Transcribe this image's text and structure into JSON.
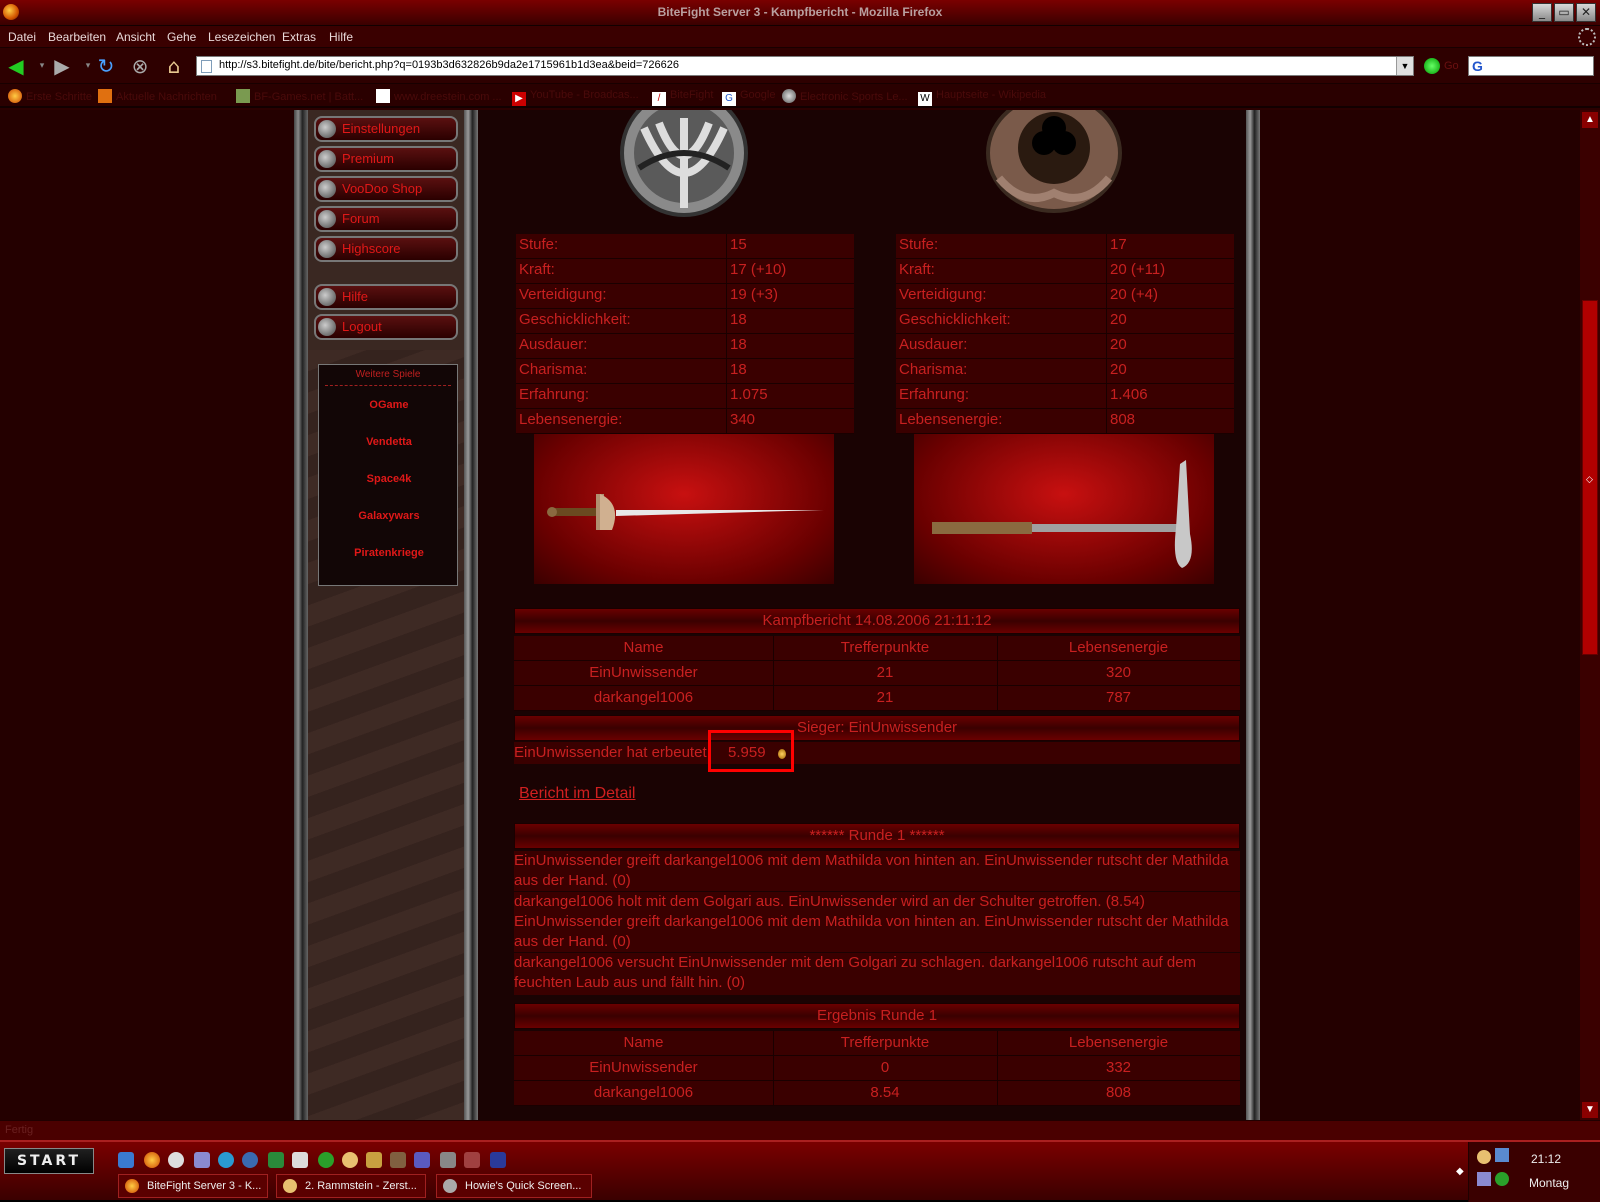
{
  "window": {
    "title": "BiteFight Server 3 - Kampfbericht - Mozilla Firefox",
    "controls": [
      "_",
      "▭",
      "✕"
    ]
  },
  "menu": [
    "Datei",
    "Bearbeiten",
    "Ansicht",
    "Gehe",
    "Lesezeichen",
    "Extras",
    "Hilfe"
  ],
  "nav": {
    "url": "http://s3.bitefight.de/bite/bericht.php?q=0193b3d632826b9da2e1715961b1d3ea&beid=726626",
    "go_label": "Go",
    "search_logo": "G"
  },
  "bookmarks": [
    "Erste Schritte",
    "Aktuelle Nachrichten",
    "BF-Games.net | Batt...",
    "www.dreestein.com ...",
    "YouTube - Broadcas...",
    "BiteFight",
    "Google",
    "Electronic Sports Le...",
    "Hauptseite - Wikipedia"
  ],
  "sidebar": {
    "buttons": [
      "Einstellungen",
      "Premium",
      "VooDoo Shop",
      "Forum",
      "Highscore",
      "Hilfe",
      "Logout"
    ],
    "games_header": "Weitere Spiele",
    "games": [
      "OGame",
      "Vendetta",
      "Space4k",
      "Galaxywars",
      "Piratenkriege"
    ]
  },
  "fighters": {
    "left": {
      "stats": [
        {
          "k": "Stufe:",
          "v": "15"
        },
        {
          "k": "Kraft:",
          "v": "17 (+10)"
        },
        {
          "k": "Verteidigung:",
          "v": "19 (+3)"
        },
        {
          "k": "Geschicklichkeit:",
          "v": "18"
        },
        {
          "k": "Ausdauer:",
          "v": "18"
        },
        {
          "k": "Charisma:",
          "v": "18"
        },
        {
          "k": "Erfahrung:",
          "v": "1.075"
        },
        {
          "k": "Lebensenergie:",
          "v": "340"
        }
      ]
    },
    "right": {
      "stats": [
        {
          "k": "Stufe:",
          "v": "17"
        },
        {
          "k": "Kraft:",
          "v": "20 (+11)"
        },
        {
          "k": "Verteidigung:",
          "v": "20 (+4)"
        },
        {
          "k": "Geschicklichkeit:",
          "v": "20"
        },
        {
          "k": "Ausdauer:",
          "v": "20"
        },
        {
          "k": "Charisma:",
          "v": "20"
        },
        {
          "k": "Erfahrung:",
          "v": "1.406"
        },
        {
          "k": "Lebensenergie:",
          "v": "808"
        }
      ]
    }
  },
  "report": {
    "title": "Kampfbericht 14.08.2006 21:11:12",
    "headers": [
      "Name",
      "Trefferpunkte",
      "Lebensenergie"
    ],
    "rows": [
      [
        "EinUnwissender",
        "21",
        "320"
      ],
      [
        "darkangel1006",
        "21",
        "787"
      ]
    ],
    "winner": "Sieger: EinUnwissender",
    "loot_text": "EinUnwissender hat erbeutet:",
    "loot_value": "5.959",
    "detail_link": "Bericht im Detail"
  },
  "round": {
    "title": "****** Runde 1 ******",
    "lines": [
      "EinUnwissender greift darkangel1006 mit dem Mathilda von hinten an. EinUnwissender rutscht der Mathilda aus der Hand. (0)",
      "darkangel1006 holt mit dem Golgari aus. EinUnwissender wird an der Schulter getroffen. (8.54)",
      "EinUnwissender greift darkangel1006 mit dem Mathilda von hinten an. EinUnwissender rutscht der Mathilda aus der Hand. (0)",
      "darkangel1006 versucht EinUnwissender mit dem Golgari zu schlagen. darkangel1006 rutscht auf dem feuchten Laub aus und fällt hin. (0)"
    ]
  },
  "result": {
    "title": "Ergebnis Runde 1",
    "headers": [
      "Name",
      "Trefferpunkte",
      "Lebensenergie"
    ],
    "rows": [
      [
        "EinUnwissender",
        "0",
        "332"
      ],
      [
        "darkangel1006",
        "8.54",
        "808"
      ]
    ]
  },
  "status": "Fertig",
  "taskbar": {
    "start": "START",
    "tasks": [
      "BiteFight Server 3 - K...",
      "2. Rammstein - Zerst...",
      "Howie's Quick Screen..."
    ],
    "time": "21:12",
    "day": "Montag"
  }
}
